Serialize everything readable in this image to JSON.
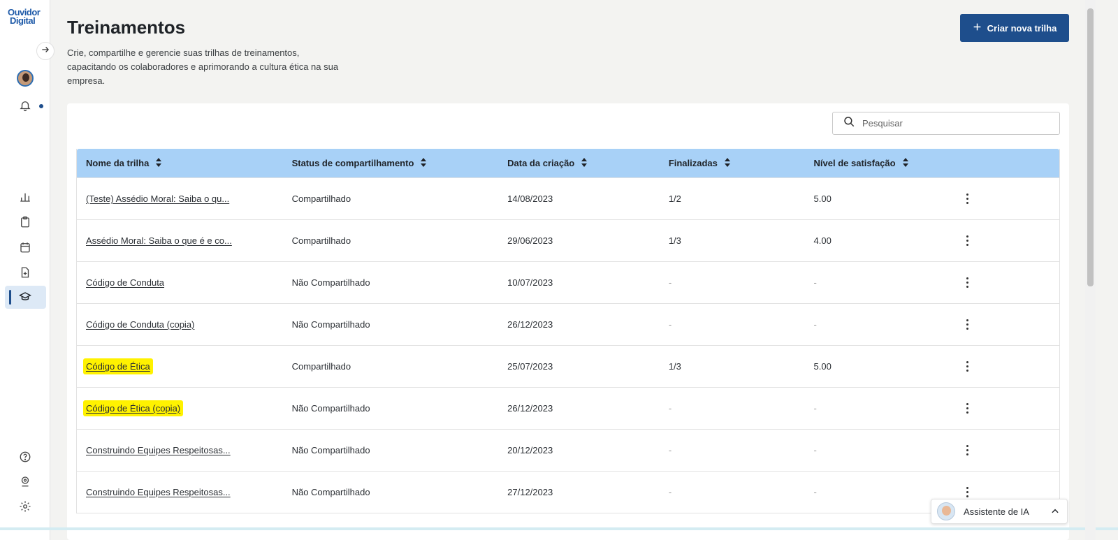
{
  "logo": {
    "line1": "Ouvidor",
    "line2": "Digital"
  },
  "header": {
    "title": "Treinamentos",
    "description": "Crie, compartilhe e gerencie suas trilhas de treinamentos, capacitando os colaboradores e aprimorando a cultura ética na sua empresa.",
    "create_button": "Criar nova trilha"
  },
  "search": {
    "placeholder": "Pesquisar"
  },
  "table": {
    "columns": [
      "Nome da trilha",
      "Status de compartilhamento",
      "Data da criação",
      "Finalizadas",
      "Nível de satisfação"
    ],
    "rows": [
      {
        "name": "(Teste) Assédio Moral: Saiba o qu...",
        "status": "Compartilhado",
        "date": "14/08/2023",
        "finished": "1/2",
        "satisfaction": "5.00",
        "highlighted": false
      },
      {
        "name": "Assédio Moral: Saiba o que é e co...",
        "status": "Compartilhado",
        "date": "29/06/2023",
        "finished": "1/3",
        "satisfaction": "4.00",
        "highlighted": false
      },
      {
        "name": "Código de Conduta",
        "status": "Não Compartilhado",
        "date": "10/07/2023",
        "finished": "-",
        "satisfaction": "-",
        "highlighted": false
      },
      {
        "name": "Código de Conduta (copia)",
        "status": "Não Compartilhado",
        "date": "26/12/2023",
        "finished": "-",
        "satisfaction": "-",
        "highlighted": false
      },
      {
        "name": "Código de Ética",
        "status": "Compartilhado",
        "date": "25/07/2023",
        "finished": "1/3",
        "satisfaction": "5.00",
        "highlighted": true
      },
      {
        "name": "Código de Ética (copia)",
        "status": "Não Compartilhado",
        "date": "26/12/2023",
        "finished": "-",
        "satisfaction": "-",
        "highlighted": true
      },
      {
        "name": "Construindo Equipes Respeitosas...",
        "status": "Não Compartilhado",
        "date": "20/12/2023",
        "finished": "-",
        "satisfaction": "-",
        "highlighted": false
      },
      {
        "name": "Construindo Equipes Respeitosas...",
        "status": "Não Compartilhado",
        "date": "27/12/2023",
        "finished": "-",
        "satisfaction": "-",
        "highlighted": false
      }
    ]
  },
  "assistant": {
    "label": "Assistente de IA"
  },
  "colors": {
    "primary": "#1e4e8c",
    "table_header": "#a8d1f7",
    "highlight": "#fff200"
  }
}
